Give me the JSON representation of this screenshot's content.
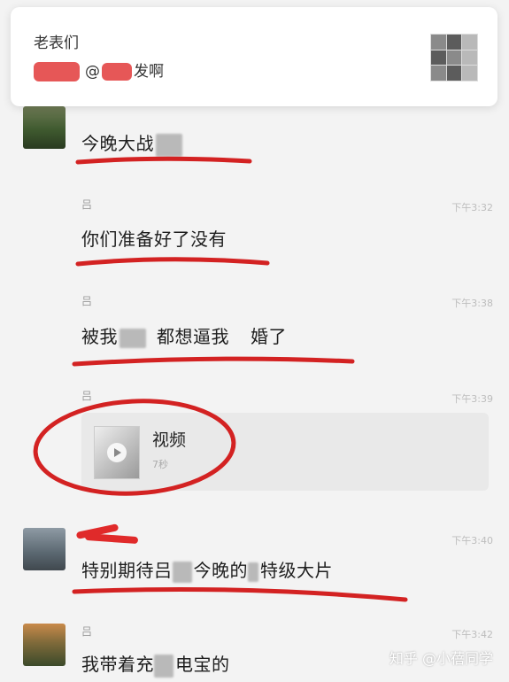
{
  "notification": {
    "group_name": "老表们",
    "message_prefix": "@",
    "message_suffix": "发啊"
  },
  "messages": [
    {
      "sender": "",
      "text": "今晚大战",
      "time": ""
    },
    {
      "sender": "吕",
      "text": "你们准备好了没有",
      "time": "下午3:32"
    },
    {
      "sender": "吕",
      "text_part1": "被我",
      "text_part2": "都想逼我",
      "text_part3": "婚了",
      "time": "下午3:38"
    },
    {
      "sender": "吕",
      "video_label": "视频",
      "video_duration": "7秒",
      "time": "下午3:39"
    },
    {
      "sender": "",
      "text_part1": "特别期待吕",
      "text_part2": "今晚的",
      "text_part3": "特级大片",
      "time": "下午3:40"
    },
    {
      "sender": "吕",
      "text_part1": "我带着充",
      "text_part2": "电宝的",
      "time": "下午3:42"
    }
  ],
  "watermark": "知乎 @小蓓同学",
  "colors": {
    "annotation_red": "#d32222",
    "background": "#f3f3f3"
  }
}
